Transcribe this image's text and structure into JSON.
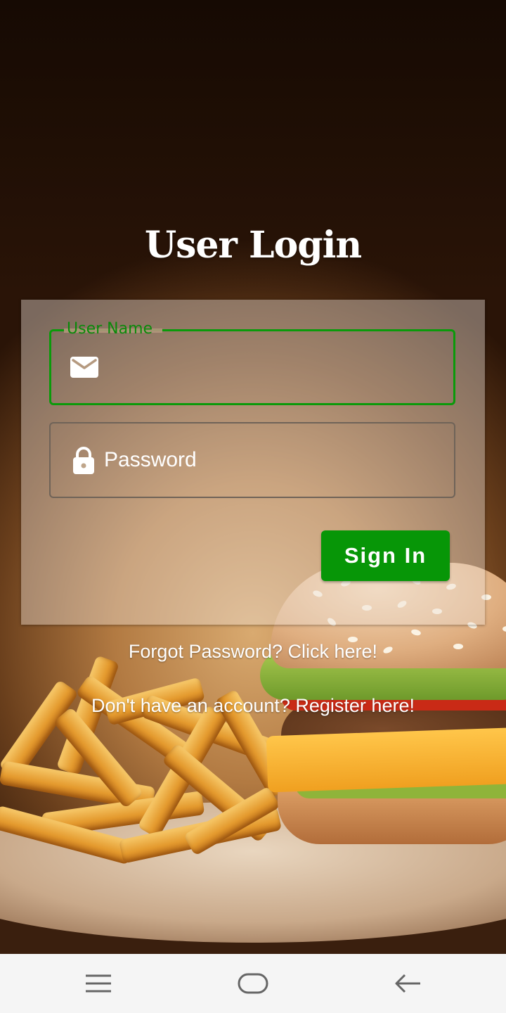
{
  "screen": {
    "title": "User Login"
  },
  "form": {
    "username": {
      "label": "User Name",
      "value": "",
      "icon": "mail-icon"
    },
    "password": {
      "placeholder": "Password",
      "value": "",
      "icon": "lock-icon"
    },
    "signin_label": "Sign In"
  },
  "links": {
    "forgot": "Forgot Password? Click here!",
    "register": "Don't have an account? Register here!"
  },
  "navbar": {
    "items": [
      "menu-icon",
      "home-icon",
      "back-icon"
    ]
  },
  "colors": {
    "accent": "#079607",
    "focus_border": "#0a9a0a",
    "navbar_bg": "#f5f5f5"
  }
}
